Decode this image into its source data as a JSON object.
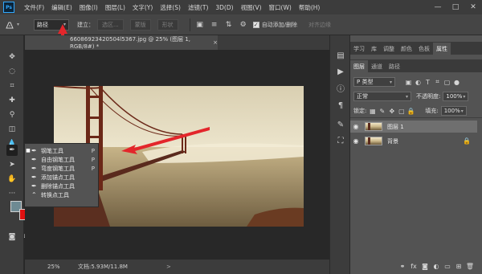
{
  "app": {
    "logo": "Ps"
  },
  "menu": [
    "文件(F)",
    "编辑(E)",
    "图像(I)",
    "图层(L)",
    "文字(Y)",
    "选择(S)",
    "滤镜(T)",
    "3D(D)",
    "视图(V)",
    "窗口(W)",
    "帮助(H)"
  ],
  "window_controls": [
    "—",
    "□",
    "✕"
  ],
  "options": {
    "mode_value": "路径",
    "build_label": "建立：",
    "selection_button": "选区...",
    "mask_button": "蒙版",
    "shape_button": "形状",
    "auto_add_delete_label": "自动添加/删除",
    "auto_add_delete_checked": true,
    "align_edges_label": "对齐边缘"
  },
  "document": {
    "tab_title": "66086923420504l5367.jpg @ 25% (图层 1, RGB/8#) *",
    "tab_close": "×",
    "zoom": "25%",
    "doc_info": "文档:5.93M/11.8M",
    "status_arrow": ">"
  },
  "pen_flyout": {
    "items": [
      {
        "label": "钢笔工具",
        "shortcut": "P",
        "active": true
      },
      {
        "label": "自由钢笔工具",
        "shortcut": "P",
        "active": false
      },
      {
        "label": "弯度钢笔工具",
        "shortcut": "P",
        "active": false
      },
      {
        "label": "添加锚点工具",
        "shortcut": "",
        "active": false
      },
      {
        "label": "删除锚点工具",
        "shortcut": "",
        "active": false
      },
      {
        "label": "转换点工具",
        "shortcut": "",
        "active": false
      }
    ]
  },
  "panels": {
    "top_tabs": [
      "学习",
      "库",
      "调整",
      "颜色",
      "色板",
      "属性"
    ],
    "active_top_tab": "属性",
    "layer_tabs": [
      "图层",
      "通道",
      "路径"
    ],
    "active_layer_tab": "图层",
    "filter_kind": "P 类型",
    "blend_mode": "正常",
    "opacity_label": "不透明度:",
    "opacity_value": "100%",
    "lock_label": "锁定:",
    "fill_label": "填充:",
    "fill_value": "100%",
    "layers": [
      {
        "name": "图层 1",
        "selected": true,
        "locked": false
      },
      {
        "name": "背景",
        "selected": false,
        "locked": true
      }
    ]
  },
  "colors": {
    "foreground": "#6e8a93",
    "background": "#e01010",
    "annotation_arrow": "#e3262b"
  }
}
